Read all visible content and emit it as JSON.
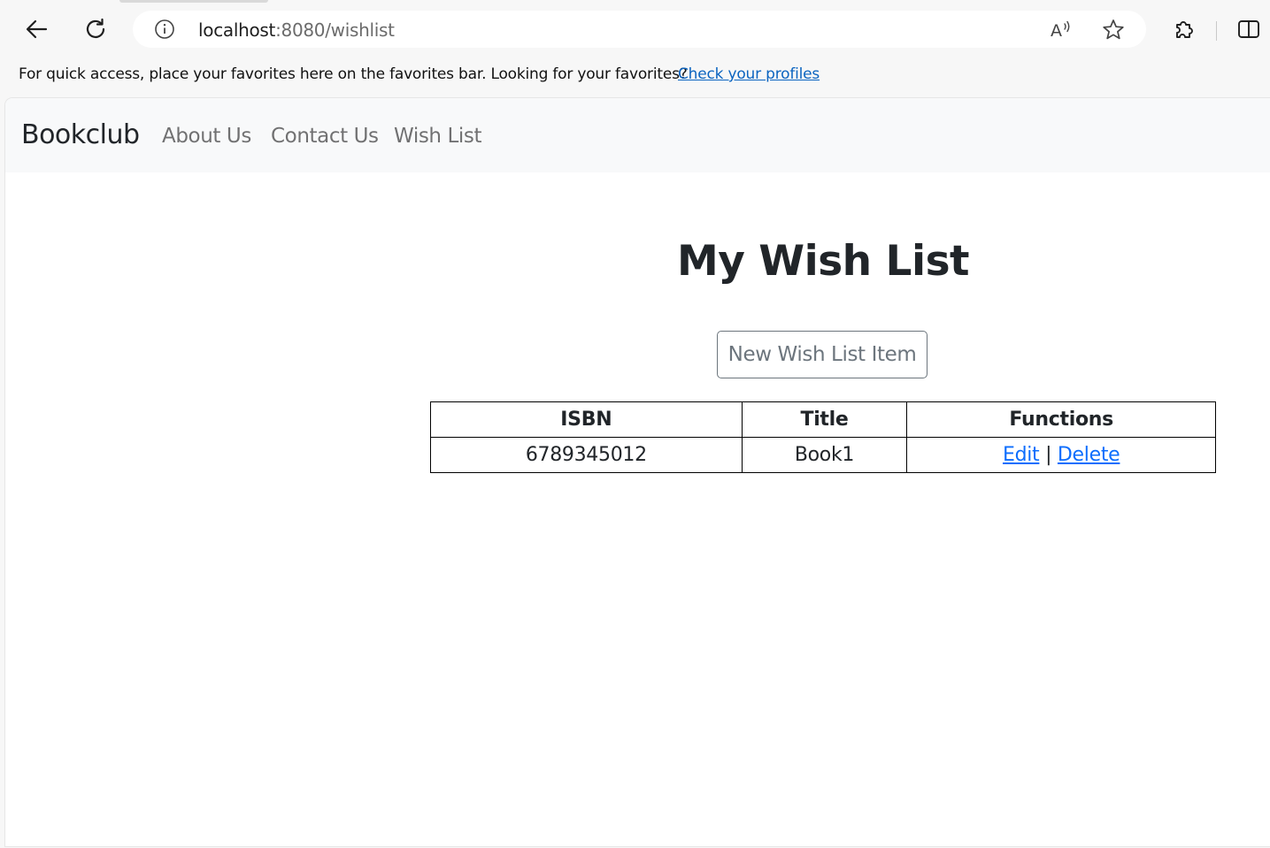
{
  "browser": {
    "url_host": "localhost",
    "url_rest": ":8080/wishlist",
    "favorites_message": "For quick access, place your favorites here on the favorites bar. Looking for your favorites?",
    "favorites_link": "Check your profiles"
  },
  "navbar": {
    "brand": "Bookclub",
    "links": [
      "About Us",
      "Contact Us",
      "Wish List"
    ]
  },
  "main": {
    "title": "My Wish List",
    "new_button": "New Wish List Item",
    "table": {
      "headers": [
        "ISBN",
        "Title",
        "Functions"
      ],
      "rows": [
        {
          "isbn": "6789345012",
          "title": "Book1",
          "edit": "Edit",
          "separator": "|",
          "delete": "Delete"
        }
      ]
    }
  },
  "colors": {
    "navbar_bg": "#f8f9fa",
    "link": "#0d6efd",
    "button_outline": "#6c757d"
  },
  "icons": [
    "back-arrow-icon",
    "refresh-icon",
    "info-icon",
    "read-aloud-icon",
    "favorite-star-icon",
    "extensions-icon",
    "split-screen-icon"
  ]
}
